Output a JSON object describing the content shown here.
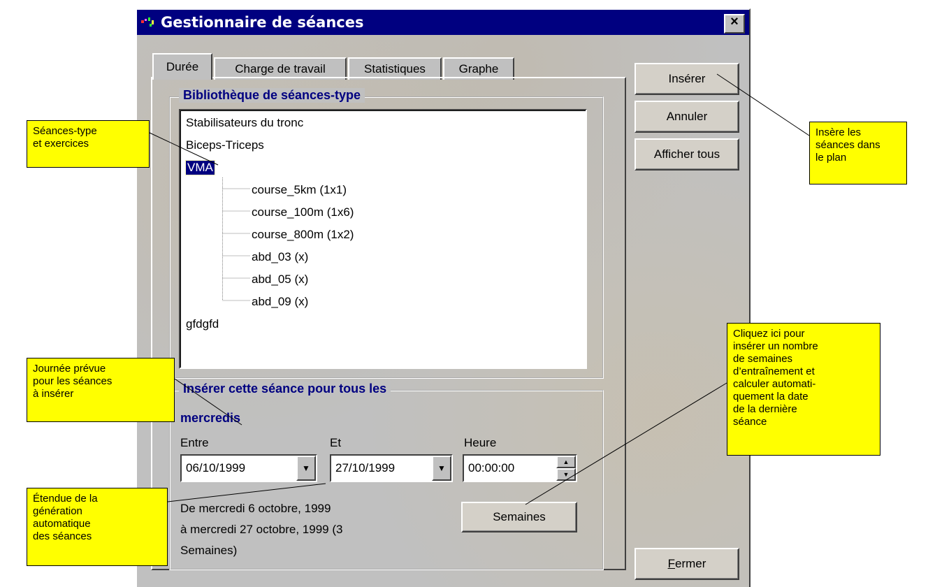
{
  "window": {
    "title": "Gestionnaire de séances",
    "close_label": "×"
  },
  "tabs": [
    {
      "label": "Durée"
    },
    {
      "label": "Charge de travail"
    },
    {
      "label": "Statistiques"
    },
    {
      "label": "Graphe"
    }
  ],
  "buttons": {
    "inserer": "Insérer",
    "annuler": "Annuler",
    "afficher_tous": "Afficher tous",
    "fermer_rest": "ermer",
    "fermer_mnemonic": "F",
    "semaines": "Semaines"
  },
  "library": {
    "label": "Bibliothèque de séances-type",
    "items": [
      "Stabilisateurs du tronc",
      "Biceps-Triceps",
      "VMA",
      "gfdgfd"
    ],
    "children": [
      "course_5km (1x1)",
      "course_100m (1x6)",
      "course_800m (1x2)",
      "abd_03 (x)",
      "abd_05 (x)",
      "abd_09 (x)"
    ]
  },
  "insert": {
    "label": "Insérer cette séance pour tous les",
    "day": "mercredis",
    "entre_label": "Entre",
    "et_label": "Et",
    "heure_label": "Heure",
    "start_date": "06/10/1999",
    "end_date": "27/10/1999",
    "time": "00:00:00",
    "range_line1": "De mercredi 6 octobre, 1999",
    "range_line2": "à mercredi 27 octobre, 1999 (3",
    "range_line3": "Semaines)"
  },
  "annotations": {
    "seances": [
      "Séances-type",
      "et exercices"
    ],
    "journee": [
      "Journée prévue",
      "pour les séances",
      "à insérer"
    ],
    "etendue": [
      "Étendue de la",
      "génération",
      "automatique",
      "des séances"
    ],
    "insere": [
      "Insère les",
      "séances dans",
      "le plan"
    ],
    "cliquez": [
      "Cliquez ici pour",
      "insérer un nombre",
      "de semaines",
      "d’entraînement et",
      "calculer automati-",
      "quement la date",
      "de la dernière",
      "séance"
    ]
  },
  "colors": {
    "titlebar": "#000080",
    "note": "#ffff00",
    "selection": "#000080",
    "group_label": "#000080"
  }
}
